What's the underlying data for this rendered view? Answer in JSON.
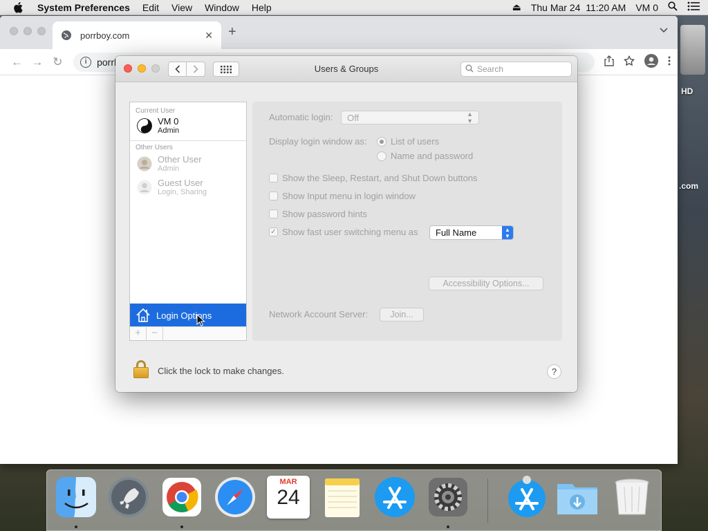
{
  "menubar": {
    "app_name": "System Preferences",
    "items": [
      "Edit",
      "View",
      "Window",
      "Help"
    ],
    "clock": "Thu Mar 24  11:20 AM",
    "user": "VM 0"
  },
  "desktop": {
    "labels": [
      "HD",
      ".com"
    ]
  },
  "browser": {
    "tab_title": "porrboy.com",
    "url": "porrboy.com"
  },
  "window": {
    "title": "Users & Groups",
    "search_placeholder": "Search"
  },
  "users": {
    "current_user_header": "Current User",
    "current": {
      "name": "VM 0",
      "role": "Admin"
    },
    "other_users_header": "Other Users",
    "others": [
      {
        "name": "Other User",
        "role": "Admin"
      },
      {
        "name": "Guest User",
        "role": "Login, Sharing"
      }
    ],
    "login_options": "Login Options"
  },
  "options": {
    "automatic_login_label": "Automatic login:",
    "automatic_login_value": "Off",
    "display_login_label": "Display login window as:",
    "radio_list": "List of users",
    "radio_name": "Name and password",
    "chk_sleep": "Show the Sleep, Restart, and Shut Down buttons",
    "chk_input": "Show Input menu in login window",
    "chk_hints": "Show password hints",
    "chk_fast": "Show fast user switching menu as",
    "fast_value": "Full Name",
    "accessibility_button": "Accessibility Options...",
    "network_label": "Network Account Server:",
    "join_button": "Join..."
  },
  "footer": {
    "lock_text": "Click the lock to make changes.",
    "help": "?"
  },
  "dock": {
    "calendar_month": "MAR",
    "calendar_day": "24"
  }
}
